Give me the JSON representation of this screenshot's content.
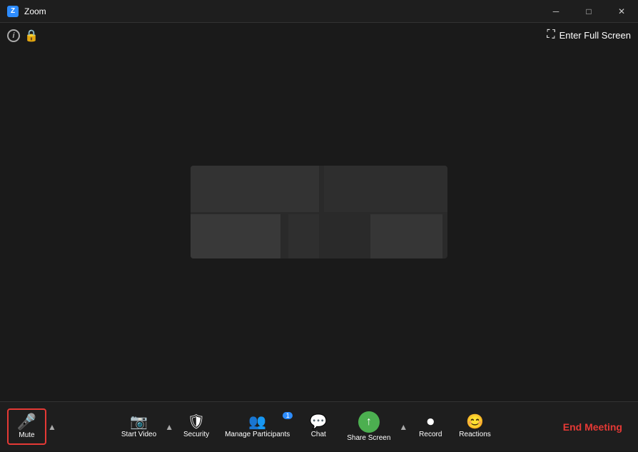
{
  "window": {
    "title": "Zoom",
    "controls": {
      "minimize": "─",
      "maximize": "□",
      "close": "✕"
    }
  },
  "header": {
    "fullscreen_label": "Enter Full Screen"
  },
  "toolbar": {
    "mute_label": "Mute",
    "start_video_label": "Start Video",
    "security_label": "Security",
    "manage_participants_label": "Manage Participants",
    "participants_count": "1",
    "chat_label": "Chat",
    "share_screen_label": "Share Screen",
    "record_label": "Record",
    "reactions_label": "Reactions",
    "end_meeting_label": "End Meeting"
  }
}
